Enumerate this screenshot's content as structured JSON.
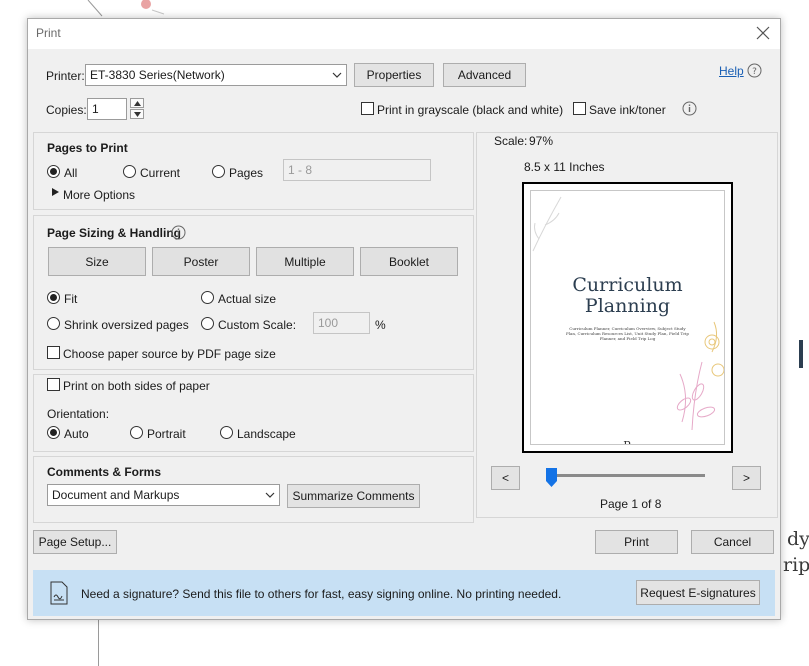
{
  "background": {
    "text_right_1": "dy",
    "text_right_2": "rip"
  },
  "dialog": {
    "title": "Print",
    "close_icon": "close-icon"
  },
  "printer": {
    "label": "Printer:",
    "selected": "ET-3830 Series(Network)",
    "properties_label": "Properties",
    "advanced_label": "Advanced",
    "help_label": "Help"
  },
  "copies": {
    "label": "Copies:",
    "value": "1",
    "grayscale_label": "Print in grayscale (black and white)",
    "save_ink_label": "Save ink/toner"
  },
  "pages_to_print": {
    "heading": "Pages to Print",
    "all_label": "All",
    "current_label": "Current",
    "pages_label": "Pages",
    "pages_value": "1 - 8",
    "more_options_label": "More Options"
  },
  "page_sizing": {
    "heading": "Page Sizing & Handling",
    "size_label": "Size",
    "poster_label": "Poster",
    "multiple_label": "Multiple",
    "booklet_label": "Booklet",
    "fit_label": "Fit",
    "actual_size_label": "Actual size",
    "shrink_label": "Shrink oversized pages",
    "custom_scale_label": "Custom Scale:",
    "custom_scale_value": "100",
    "percent_label": "%",
    "paper_source_label": "Choose paper source by PDF page size"
  },
  "duplex": {
    "both_sides_label": "Print on both sides of paper",
    "orientation_label": "Orientation:",
    "auto_label": "Auto",
    "portrait_label": "Portrait",
    "landscape_label": "Landscape"
  },
  "comments": {
    "heading": "Comments & Forms",
    "selected": "Document and Markups",
    "summarize_label": "Summarize Comments"
  },
  "preview": {
    "scale_label": "Scale:",
    "scale_value": "97%",
    "paper_size": "8.5 x 11 Inches",
    "doc_title_line1": "Curriculum",
    "doc_title_line2": "Planning",
    "doc_subtitle": "Curriculum Planner, Curriculum Overview, Subject Study Plan, Curriculum Resources List, Unit Study Plan, Field Trip Planner, and Field Trip Log",
    "prev_label": "<",
    "next_label": ">",
    "page_indicator": "Page 1 of 8",
    "slider_position": 0
  },
  "footer": {
    "page_setup_label": "Page Setup...",
    "print_label": "Print",
    "cancel_label": "Cancel"
  },
  "banner": {
    "message": "Need a signature? Send this file to others for fast, easy signing online. No printing needed.",
    "request_label": "Request E-signatures"
  }
}
